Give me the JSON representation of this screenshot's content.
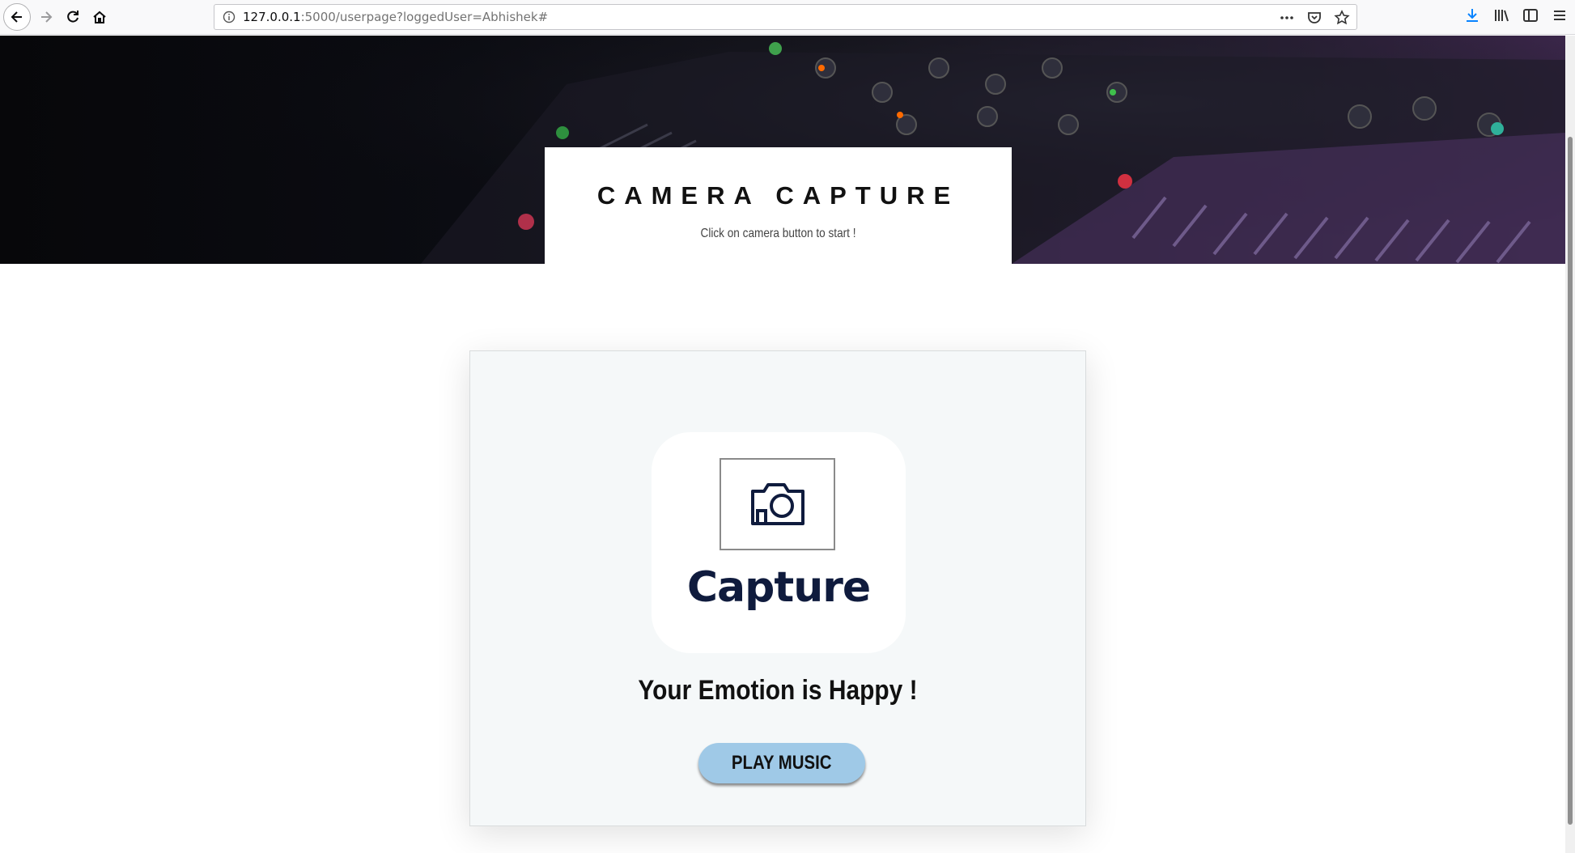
{
  "browser": {
    "url_host": "127.0.0.1",
    "url_rest": ":5000/userpage?loggedUser=Abhishek#",
    "icons": [
      "back-icon",
      "forward-icon",
      "reload-icon",
      "home-icon",
      "info-icon",
      "more-icon",
      "pocket-icon",
      "bookmark-star-icon",
      "download-icon",
      "library-icon",
      "sidebar-icon",
      "menu-icon"
    ]
  },
  "hero": {
    "title": "CAMERA CAPTURE",
    "subtitle": "Click on camera button to start !"
  },
  "card": {
    "capture_label": "Capture",
    "emotion_text": "Your Emotion is Happy !",
    "play_button_label": "PLAY MUSIC"
  },
  "colors": {
    "capture_text": "#0f1b3d",
    "play_button_bg": "#9fc9e7",
    "card_bg": "#f5f8f9"
  }
}
